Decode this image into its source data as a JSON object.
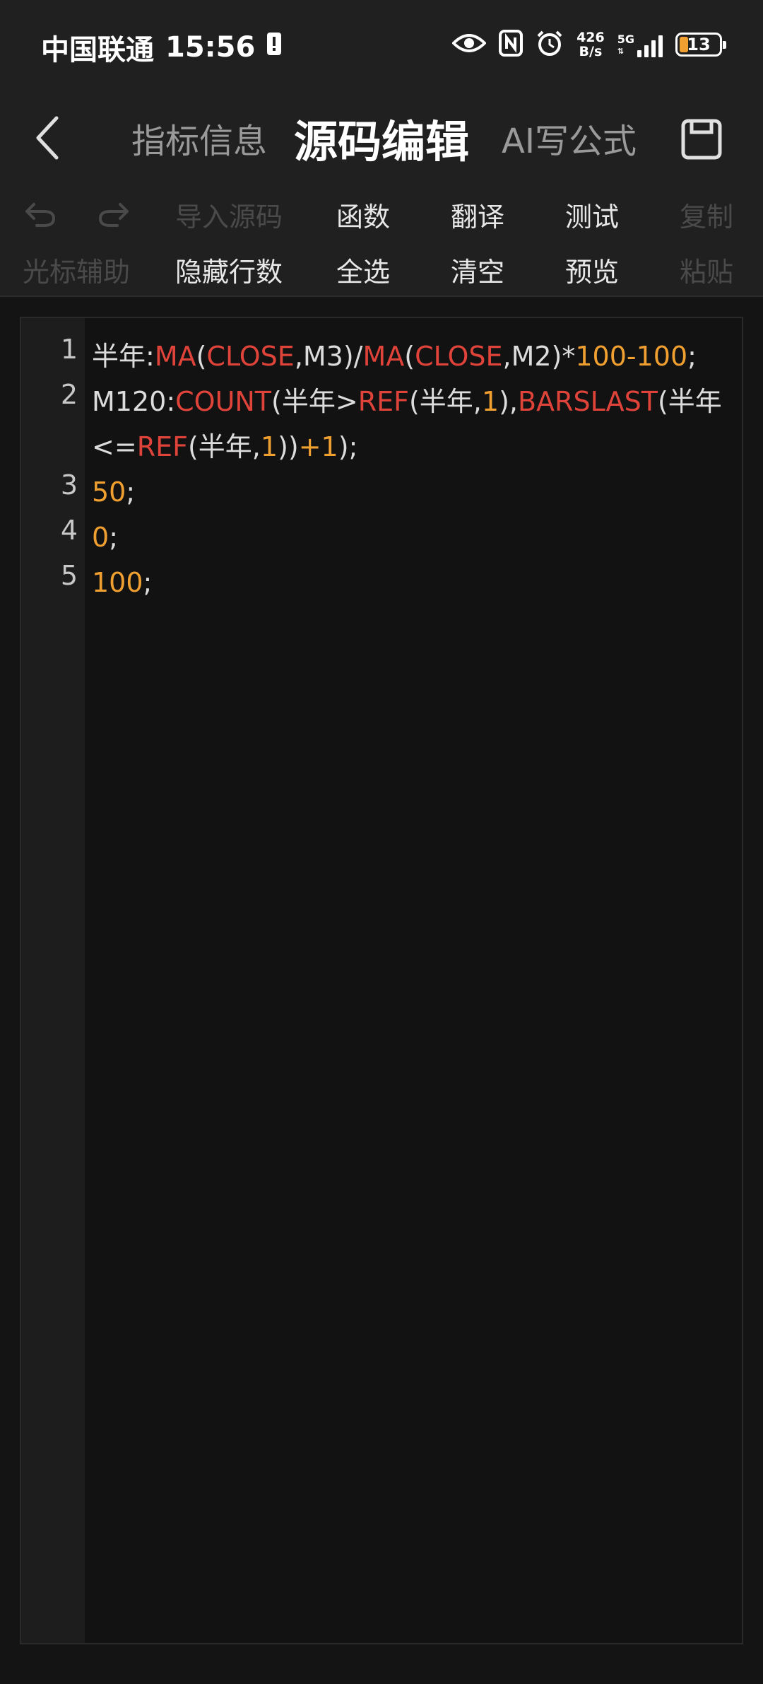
{
  "status_bar": {
    "carrier": "中国联通",
    "time": "15:56",
    "net_speed_value": "426",
    "net_speed_unit": "B/s",
    "network_type": "5G",
    "battery_level": "13",
    "icons": [
      "alert-icon",
      "eye-icon",
      "nfc-icon",
      "alarm-icon",
      "signal-icon",
      "battery-icon"
    ]
  },
  "header": {
    "tabs": [
      {
        "label": "指标信息",
        "active": false
      },
      {
        "label": "源码编辑",
        "active": true
      },
      {
        "label": "AI写公式",
        "active": false
      }
    ]
  },
  "toolbar": {
    "row1": [
      {
        "label": "导入源码",
        "enabled": false
      },
      {
        "label": "函数",
        "enabled": true
      },
      {
        "label": "翻译",
        "enabled": true
      },
      {
        "label": "测试",
        "enabled": true
      },
      {
        "label": "复制",
        "enabled": false
      }
    ],
    "row2": [
      {
        "label": "光标辅助",
        "enabled": false
      },
      {
        "label": "隐藏行数",
        "enabled": true
      },
      {
        "label": "全选",
        "enabled": true
      },
      {
        "label": "清空",
        "enabled": true
      },
      {
        "label": "预览",
        "enabled": true
      },
      {
        "label": "粘贴",
        "enabled": false
      }
    ]
  },
  "editor": {
    "colors": {
      "function": "#e0433a",
      "number": "#f0a030",
      "text": "#dcdcdc"
    },
    "lines": [
      {
        "num": "1",
        "tokens": [
          {
            "t": "半年:",
            "k": "txt"
          },
          {
            "t": "MA",
            "k": "fn"
          },
          {
            "t": "(",
            "k": "txt"
          },
          {
            "t": "CLOSE",
            "k": "fn"
          },
          {
            "t": ",M3)/",
            "k": "txt"
          },
          {
            "t": "MA",
            "k": "fn"
          },
          {
            "t": "(",
            "k": "txt"
          },
          {
            "t": "CLOSE",
            "k": "fn"
          },
          {
            "t": ",M2)*",
            "k": "txt"
          },
          {
            "t": "100-100",
            "k": "num"
          },
          {
            "t": ";",
            "k": "txt"
          }
        ]
      },
      {
        "num": "2",
        "tokens": [
          {
            "t": "M120:",
            "k": "txt"
          },
          {
            "t": "COUNT",
            "k": "fn"
          },
          {
            "t": "(半年>",
            "k": "txt"
          },
          {
            "t": "REF",
            "k": "fn"
          },
          {
            "t": "(半年,",
            "k": "txt"
          },
          {
            "t": "1",
            "k": "num"
          },
          {
            "t": "),",
            "k": "txt"
          },
          {
            "t": "BARSLAST",
            "k": "fn"
          },
          {
            "t": "(半年<=",
            "k": "txt"
          },
          {
            "t": "REF",
            "k": "fn"
          },
          {
            "t": "(半年,",
            "k": "txt"
          },
          {
            "t": "1",
            "k": "num"
          },
          {
            "t": "))",
            "k": "txt"
          },
          {
            "t": "+1",
            "k": "num"
          },
          {
            "t": ");",
            "k": "txt"
          }
        ]
      },
      {
        "num": "3",
        "tokens": [
          {
            "t": "50",
            "k": "num"
          },
          {
            "t": ";",
            "k": "txt"
          }
        ]
      },
      {
        "num": "4",
        "tokens": [
          {
            "t": "0",
            "k": "num"
          },
          {
            "t": ";",
            "k": "txt"
          }
        ]
      },
      {
        "num": "5",
        "tokens": [
          {
            "t": "100",
            "k": "num"
          },
          {
            "t": ";",
            "k": "txt"
          }
        ]
      }
    ]
  }
}
